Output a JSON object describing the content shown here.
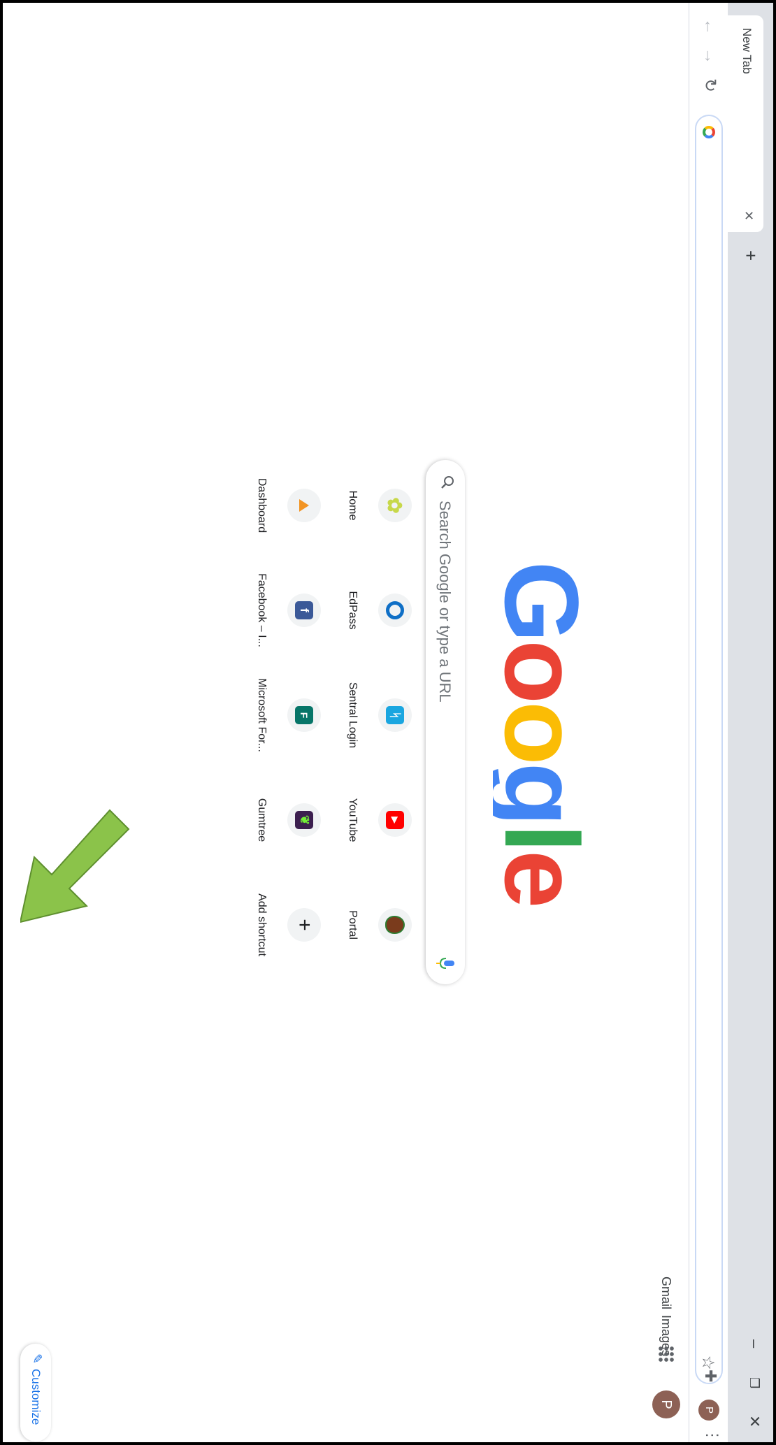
{
  "tab": {
    "title": "New Tab"
  },
  "omnibox": {
    "value": ""
  },
  "topnav": {
    "gmail": "Gmail",
    "images": "Images"
  },
  "profile": {
    "initial": "P"
  },
  "search": {
    "placeholder": "Search Google or type a URL"
  },
  "logo_text": "Google",
  "shortcuts": [
    {
      "label": "Home",
      "icon": "home-flower-icon",
      "color": "#c7d84a"
    },
    {
      "label": "EdPass",
      "icon": "edpass-ring-icon",
      "color": "#0f6fc6"
    },
    {
      "label": "Sentral Login",
      "icon": "sentral-icon",
      "color": "#1aa6e0"
    },
    {
      "label": "YouTube",
      "icon": "youtube-icon",
      "color": "#ff0000"
    },
    {
      "label": "Portal",
      "icon": "portal-shield-icon",
      "color": "#7a3b1c"
    },
    {
      "label": "Dashboard",
      "icon": "dashboard-triangle-icon",
      "color": "#f29423"
    },
    {
      "label": "Facebook – I...",
      "icon": "facebook-icon",
      "color": "#3b5998"
    },
    {
      "label": "Microsoft For...",
      "icon": "microsoft-forms-icon",
      "color": "#077568"
    },
    {
      "label": "Gumtree",
      "icon": "gumtree-icon",
      "color": "#3c1f4f"
    },
    {
      "label": "Add shortcut",
      "icon": "plus-icon",
      "color": "#202124"
    }
  ],
  "customize": {
    "label": "Customize"
  },
  "colors": {
    "tabstrip": "#dee1e6",
    "accent": "#1a73e8",
    "annotation_arrow": "#8bc34a"
  }
}
